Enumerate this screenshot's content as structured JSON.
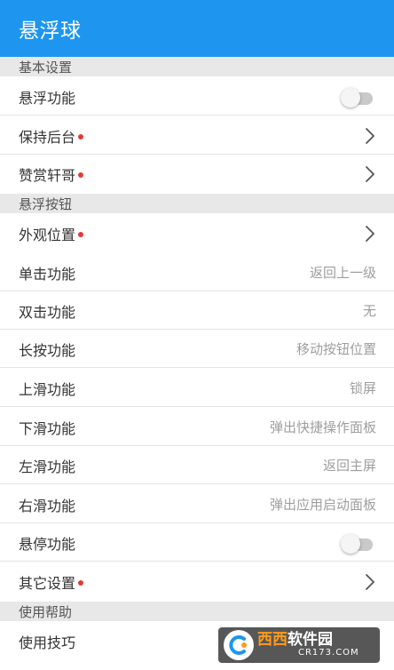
{
  "appbar": {
    "title": "悬浮球"
  },
  "colors": {
    "appbar": "#1e96f0",
    "section_bg": "#e8e8e8",
    "badge_dot": "#e53935",
    "value_text": "#9e9e9e"
  },
  "sections": {
    "basic": {
      "header": "基本设置",
      "float_function": {
        "label": "悬浮功能",
        "enabled": false
      },
      "keep_background": {
        "label": "保持后台",
        "badge": true
      },
      "praise": {
        "label": "赞赏轩哥",
        "badge": true
      }
    },
    "button": {
      "header": "悬浮按钮",
      "appearance": {
        "label": "外观位置",
        "badge": true
      },
      "single_tap": {
        "label": "单击功能",
        "value": "返回上一级"
      },
      "double_tap": {
        "label": "双击功能",
        "value": "无"
      },
      "long_press": {
        "label": "长按功能",
        "value": "移动按钮位置"
      },
      "swipe_up": {
        "label": "上滑功能",
        "value": "锁屏"
      },
      "swipe_down": {
        "label": "下滑功能",
        "value": "弹出快捷操作面板"
      },
      "swipe_left": {
        "label": "左滑功能",
        "value": "返回主屏"
      },
      "swipe_right": {
        "label": "右滑功能",
        "value": "弹出应用启动面板"
      },
      "hover": {
        "label": "悬停功能",
        "enabled": false
      },
      "other": {
        "label": "其它设置",
        "badge": true
      }
    },
    "help": {
      "header": "使用帮助",
      "tips": {
        "label": "使用技巧"
      }
    }
  },
  "watermark": {
    "brand_part1": "西西",
    "brand_part2": "软件园",
    "site": "CR173.COM",
    "icon": "cr173-logo-icon"
  },
  "icons": {
    "chevron": "chevron-right-icon",
    "toggle": "toggle-switch-icon",
    "badge": "red-dot-badge"
  }
}
